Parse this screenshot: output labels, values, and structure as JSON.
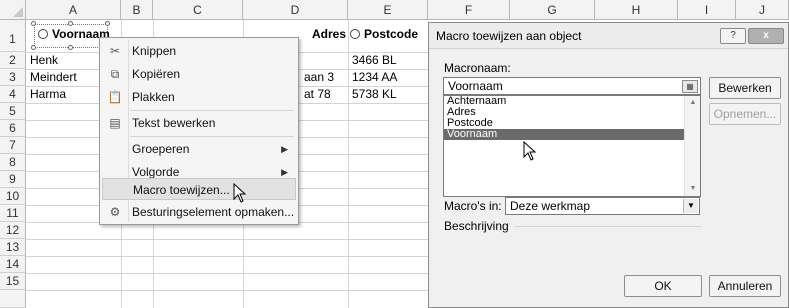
{
  "columns": [
    "A",
    "B",
    "C",
    "D",
    "E",
    "F",
    "G",
    "H",
    "I",
    "J"
  ],
  "rows": [
    "1",
    "2",
    "3",
    "4",
    "5",
    "6",
    "7",
    "8",
    "9",
    "10",
    "11",
    "12",
    "13",
    "14",
    "15"
  ],
  "cells": {
    "a2": "Henk",
    "a3": "Meindert",
    "a4": "Harma",
    "d3": "aan 3",
    "d4": "at 78",
    "e2": "3466 BL",
    "e3": "1234 AA",
    "e4": "5738 KL"
  },
  "options": {
    "voornaam": "Voornaam",
    "achternaam": "Achternaam",
    "adres": "Adres",
    "postcode": "Postcode"
  },
  "context_menu": {
    "knippen": "Knippen",
    "kopieren": "Kopiëren",
    "plakken": "Plakken",
    "tekst_bewerken": "Tekst bewerken",
    "groeperen": "Groeperen",
    "volgorde": "Volgorde",
    "macro_toewijzen": "Macro toewijzen...",
    "besturingselement": "Besturingselement opmaken..."
  },
  "dialog": {
    "title": "Macro toewijzen aan object",
    "help": "?",
    "close": "x",
    "macronaam_label": "Macronaam:",
    "macronaam_value": "Voornaam",
    "macros": [
      "Achternaam",
      "Adres",
      "Postcode",
      "Voornaam"
    ],
    "selected_macro": "Voornaam",
    "bewerken": "Bewerken",
    "opnemen": "Opnemen...",
    "macros_in_label": "Macro's in:",
    "macros_in_value": "Deze werkmap",
    "beschrijving_label": "Beschrijving",
    "ok": "OK",
    "annuleren": "Annuleren"
  },
  "icons": {
    "cut": "scissors-icon",
    "copy": "copy-icon",
    "paste": "paste-icon",
    "edit_text": "edit-text-icon",
    "format_control": "format-control-icon",
    "picker": "range-picker-icon"
  }
}
